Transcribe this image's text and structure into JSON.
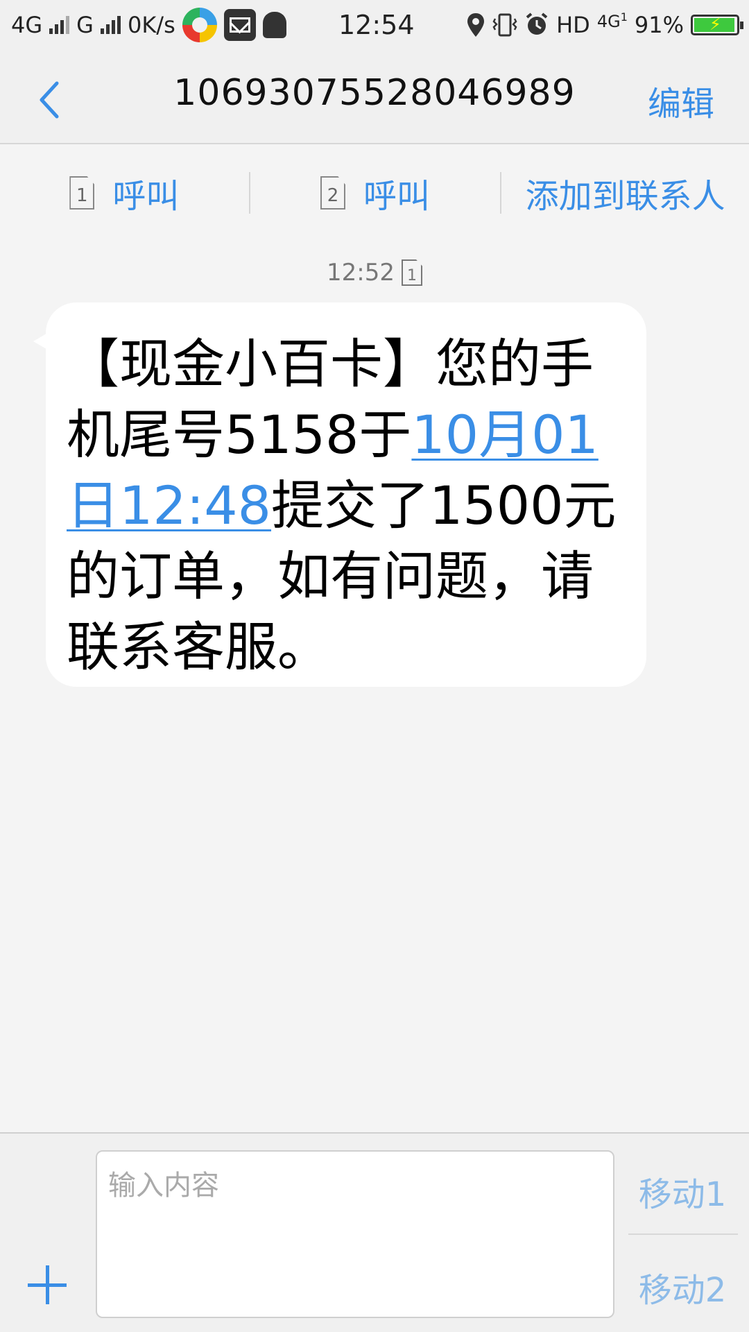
{
  "status_bar": {
    "net1": "4G",
    "net2": "G",
    "speed": "0K/s",
    "time": "12:54",
    "hd": "HD",
    "net3": "4G",
    "net3_sub": "1",
    "battery": "91%",
    "battery_level": 0.91,
    "icons": [
      "signal-icon",
      "app-icon",
      "mail-icon",
      "android-icon",
      "location-icon",
      "vibrate-icon",
      "alarm-icon",
      "battery-icon"
    ]
  },
  "header": {
    "title": "10693075528046989",
    "edit_label": "编辑"
  },
  "actions": {
    "call1_sim": "1",
    "call1_label": "呼叫",
    "call2_sim": "2",
    "call2_label": "呼叫",
    "add_contact_label": "添加到联系人"
  },
  "message": {
    "time": "12:52",
    "sim": "1",
    "text_part1": "【现金小百卡】您的手机尾号5158于",
    "link_text": "10月01日12:48",
    "text_part2": "提交了1500元的订单，如有问题，请联系客服。"
  },
  "composer": {
    "placeholder": "输入内容",
    "send1_label": "移动1",
    "send2_label": "移动2"
  },
  "colors": {
    "accent": "#3a8ee6",
    "send_inactive": "#8dbbe8",
    "background": "#f4f4f4"
  }
}
